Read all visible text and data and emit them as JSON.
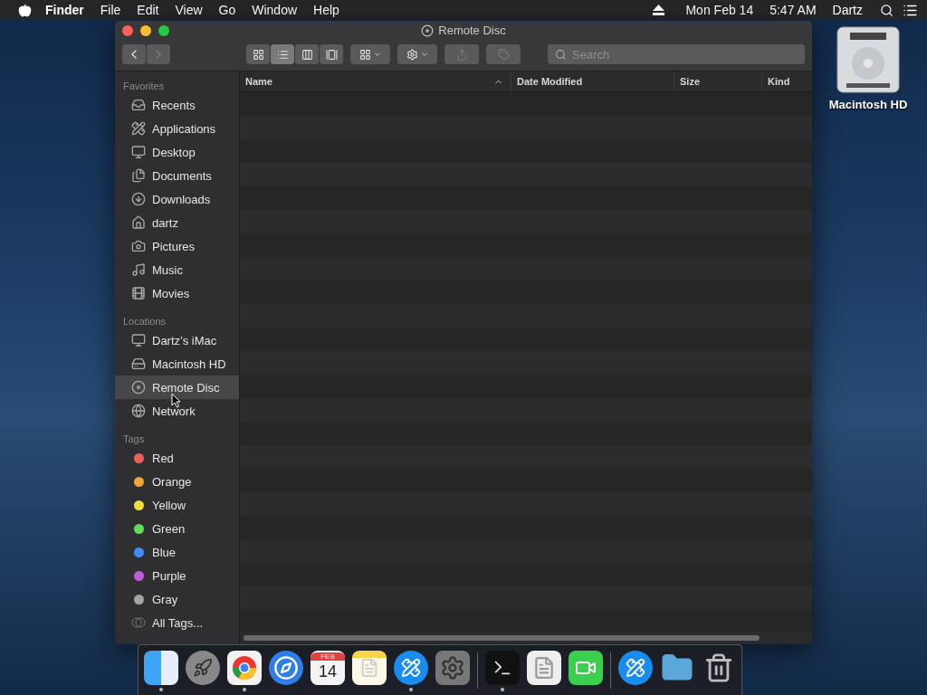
{
  "menu_bar": {
    "app": "Finder",
    "menus": [
      "File",
      "Edit",
      "View",
      "Go",
      "Window",
      "Help"
    ],
    "date": "Mon Feb 14",
    "time": "5:47 AM",
    "user": "Dartz"
  },
  "window": {
    "title": "Remote Disc"
  },
  "toolbar": {
    "view_modes": [
      {
        "kind": "icons",
        "selected": false
      },
      {
        "kind": "list",
        "selected": true
      },
      {
        "kind": "columns",
        "selected": false
      },
      {
        "kind": "gallery",
        "selected": false
      }
    ],
    "share_disabled": true,
    "tag_disabled": true,
    "search": {
      "placeholder": "Search"
    }
  },
  "sidebar": {
    "sections": [
      {
        "title": "Favorites",
        "items": [
          {
            "label": "Recents",
            "kind": "tray",
            "selected": false
          },
          {
            "label": "Applications",
            "kind": "apps",
            "selected": false
          },
          {
            "label": "Desktop",
            "kind": "desktop",
            "selected": false
          },
          {
            "label": "Documents",
            "kind": "documents",
            "selected": false
          },
          {
            "label": "Downloads",
            "kind": "downloads",
            "selected": false
          },
          {
            "label": "dartz",
            "kind": "home",
            "selected": false
          },
          {
            "label": "Pictures",
            "kind": "camera",
            "selected": false
          },
          {
            "label": "Music",
            "kind": "music",
            "selected": false
          },
          {
            "label": "Movies",
            "kind": "film",
            "selected": false
          }
        ]
      },
      {
        "title": "Locations",
        "items": [
          {
            "label": "Dartz’s iMac",
            "kind": "computer",
            "selected": false
          },
          {
            "label": "Macintosh HD",
            "kind": "drive",
            "selected": false
          },
          {
            "label": "Remote Disc",
            "kind": "disc",
            "selected": true
          },
          {
            "label": "Network",
            "kind": "globe",
            "selected": false
          }
        ]
      },
      {
        "title": "Tags",
        "items": [
          {
            "label": "Red",
            "kind": "tag",
            "color": "#ec5f5d",
            "selected": false
          },
          {
            "label": "Orange",
            "kind": "tag",
            "color": "#f0a43b",
            "selected": false
          },
          {
            "label": "Yellow",
            "kind": "tag",
            "color": "#f3dc3b",
            "selected": false
          },
          {
            "label": "Green",
            "kind": "tag",
            "color": "#5fdc5b",
            "selected": false
          },
          {
            "label": "Blue",
            "kind": "tag",
            "color": "#3e8ef7",
            "selected": false
          },
          {
            "label": "Purple",
            "kind": "tag",
            "color": "#c05cdf",
            "selected": false
          },
          {
            "label": "Gray",
            "kind": "tag",
            "color": "#a5a5a8",
            "selected": false
          },
          {
            "label": "All Tags...",
            "kind": "all_tags",
            "selected": false
          }
        ]
      }
    ]
  },
  "table": {
    "columns": [
      {
        "label": "Name",
        "sorted": true
      },
      {
        "label": "Date Modified",
        "sorted": false
      },
      {
        "label": "Size",
        "sorted": false
      },
      {
        "label": "Kind",
        "sorted": false
      }
    ]
  },
  "desktop": {
    "icons": [
      {
        "label": "Macintosh HD"
      }
    ]
  },
  "dock": {
    "items": [
      {
        "kind": "finder",
        "running": true
      },
      {
        "kind": "launchpad",
        "running": false
      },
      {
        "kind": "chrome",
        "running": true
      },
      {
        "kind": "safari",
        "running": false
      },
      {
        "kind": "calendar",
        "running": false,
        "month": "FEB",
        "day": "14"
      },
      {
        "kind": "notes",
        "running": false
      },
      {
        "kind": "appstore",
        "running": true
      },
      {
        "kind": "settings",
        "running": false
      },
      {
        "kind": "separator"
      },
      {
        "kind": "terminal",
        "running": true
      },
      {
        "kind": "textedit",
        "running": false
      },
      {
        "kind": "facetime",
        "running": false
      },
      {
        "kind": "separator"
      },
      {
        "kind": "appstore",
        "running": false
      },
      {
        "kind": "folder",
        "running": false
      },
      {
        "kind": "trash",
        "running": false
      }
    ]
  }
}
